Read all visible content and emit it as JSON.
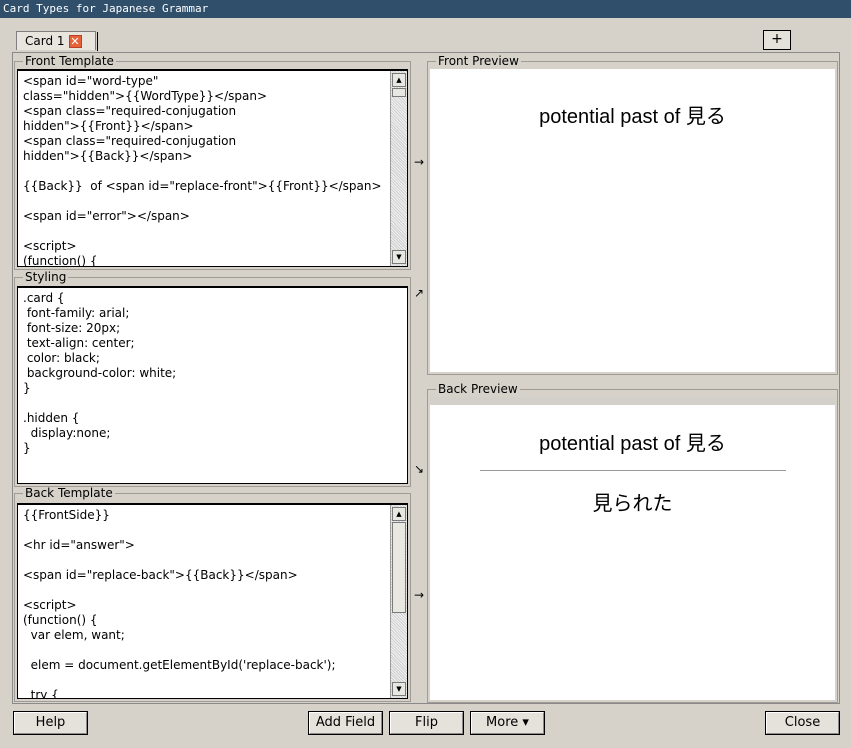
{
  "window": {
    "title": "Card Types for Japanese Grammar"
  },
  "tabs": [
    {
      "label": "Card 1",
      "close_icon": "close-icon"
    }
  ],
  "add_tab_label": "+",
  "front_template": {
    "legend": "Front Template",
    "code": "<span id=\"word-type\"\nclass=\"hidden\">{{WordType}}</span>\n<span class=\"required-conjugation\nhidden\">{{Front}}</span>\n<span class=\"required-conjugation\nhidden\">{{Back}}</span>\n\n{{Back}}  of <span id=\"replace-front\">{{Front}}</span>\n\n<span id=\"error\"></span>\n\n<script>\n(function() {"
  },
  "styling": {
    "legend": "Styling",
    "code": ".card {\n font-family: arial;\n font-size: 20px;\n text-align: center;\n color: black;\n background-color: white;\n}\n\n.hidden {\n  display:none;\n}"
  },
  "back_template": {
    "legend": "Back Template",
    "code": "{{FrontSide}}\n\n<hr id=\"answer\">\n\n<span id=\"replace-back\">{{Back}}</span>\n\n<script>\n(function() {\n  var elem, want;\n\n  elem = document.getElementById('replace-back');\n\n  try {"
  },
  "arrows": {
    "front": "→",
    "styling_front": "↗",
    "styling_back": "↘",
    "back": "→"
  },
  "front_preview": {
    "legend": "Front Preview",
    "text": "potential past of 見る"
  },
  "back_preview": {
    "legend": "Back Preview",
    "question": "potential past of 見る",
    "answer": "見られた"
  },
  "buttons": {
    "help": "Help",
    "add_field": "Add Field",
    "flip": "Flip",
    "more": "More ▾",
    "close": "Close"
  },
  "colors": {
    "title_bar": "#2f4f6b",
    "tab_close": "#e5623a",
    "dialog_bg": "#d6d2ca"
  }
}
